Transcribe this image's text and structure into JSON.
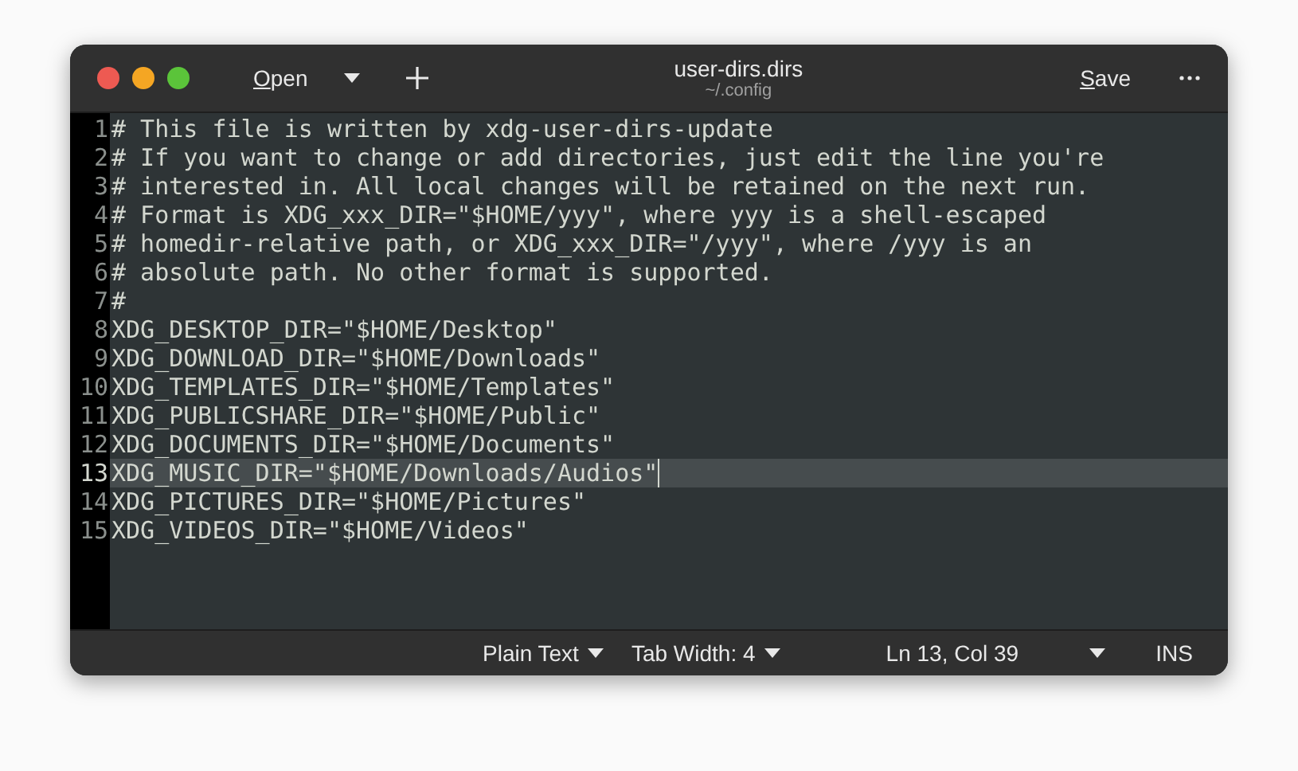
{
  "header": {
    "open_label": "Open",
    "title": "user-dirs.dirs",
    "subtitle": "~/.config",
    "save_label": "Save"
  },
  "editor": {
    "lines": [
      {
        "number": "1",
        "text": "# This file is written by xdg-user-dirs-update",
        "current": false
      },
      {
        "number": "2",
        "text": "# If you want to change or add directories, just edit the line you're",
        "current": false
      },
      {
        "number": "3",
        "text": "# interested in. All local changes will be retained on the next run.",
        "current": false
      },
      {
        "number": "4",
        "text": "# Format is XDG_xxx_DIR=\"$HOME/yyy\", where yyy is a shell-escaped",
        "current": false
      },
      {
        "number": "5",
        "text": "# homedir-relative path, or XDG_xxx_DIR=\"/yyy\", where /yyy is an",
        "current": false
      },
      {
        "number": "6",
        "text": "# absolute path. No other format is supported.",
        "current": false
      },
      {
        "number": "7",
        "text": "#",
        "current": false
      },
      {
        "number": "8",
        "text": "XDG_DESKTOP_DIR=\"$HOME/Desktop\"",
        "current": false
      },
      {
        "number": "9",
        "text": "XDG_DOWNLOAD_DIR=\"$HOME/Downloads\"",
        "current": false
      },
      {
        "number": "10",
        "text": "XDG_TEMPLATES_DIR=\"$HOME/Templates\"",
        "current": false
      },
      {
        "number": "11",
        "text": "XDG_PUBLICSHARE_DIR=\"$HOME/Public\"",
        "current": false
      },
      {
        "number": "12",
        "text": "XDG_DOCUMENTS_DIR=\"$HOME/Documents\"",
        "current": false
      },
      {
        "number": "13",
        "text": "XDG_MUSIC_DIR=\"$HOME/Downloads/Audios\"",
        "current": true
      },
      {
        "number": "14",
        "text": "XDG_PICTURES_DIR=\"$HOME/Pictures\"",
        "current": false
      },
      {
        "number": "15",
        "text": "XDG_VIDEOS_DIR=\"$HOME/Videos\"",
        "current": false
      }
    ]
  },
  "status_bar": {
    "language": "Plain Text",
    "tab_width": "Tab Width: 4",
    "position": "Ln 13, Col 39",
    "mode": "INS"
  }
}
